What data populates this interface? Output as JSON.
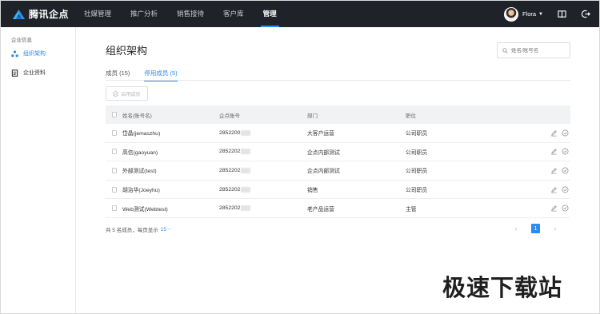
{
  "app": {
    "name": "腾讯企点"
  },
  "nav": {
    "items": [
      {
        "label": "社媒管理",
        "active": false
      },
      {
        "label": "推广分析",
        "active": false
      },
      {
        "label": "销售接待",
        "active": false
      },
      {
        "label": "客户库",
        "active": false
      },
      {
        "label": "管理",
        "active": true
      }
    ]
  },
  "user": {
    "name": "Flora"
  },
  "sidebar": {
    "group_label": "企业信息",
    "items": [
      {
        "label": "组织架构",
        "icon": "org-chart-icon",
        "active": true
      },
      {
        "label": "企业资料",
        "icon": "document-icon",
        "active": false
      }
    ]
  },
  "page": {
    "title": "组织架构",
    "search_placeholder": "姓名/账号名",
    "tabs": [
      {
        "label": "成员 (15)",
        "active": false
      },
      {
        "label": "停用成员 (5)",
        "active": true
      }
    ],
    "enable_button": "启用成员"
  },
  "table": {
    "columns": [
      "姓名(账号名)",
      "企点账号",
      "部门",
      "职位"
    ],
    "rows": [
      {
        "name": "岱晶(jemaszhu)",
        "account": "2852200",
        "dept": "大客户运营",
        "position": "公司职员"
      },
      {
        "name": "高信(gaoyuan)",
        "account": "2852202",
        "dept": "企点内部测试",
        "position": "公司职员"
      },
      {
        "name": "外部测试(test)",
        "account": "2852202",
        "dept": "企点内部测试",
        "position": "公司职员"
      },
      {
        "name": "胡治华(Joeyhu)",
        "account": "2852202",
        "dept": "销售",
        "position": "公司职员"
      },
      {
        "name": "Web测试(Webtest)",
        "account": "2852202",
        "dept": "老产品运营",
        "position": "主管"
      }
    ]
  },
  "footer": {
    "summary": "共 5 名成员，每页显示",
    "page_size": "15",
    "current_page": "1"
  },
  "watermark": "极速下载站",
  "colors": {
    "accent": "#2d8cf0",
    "topbar": "#1f2329"
  }
}
